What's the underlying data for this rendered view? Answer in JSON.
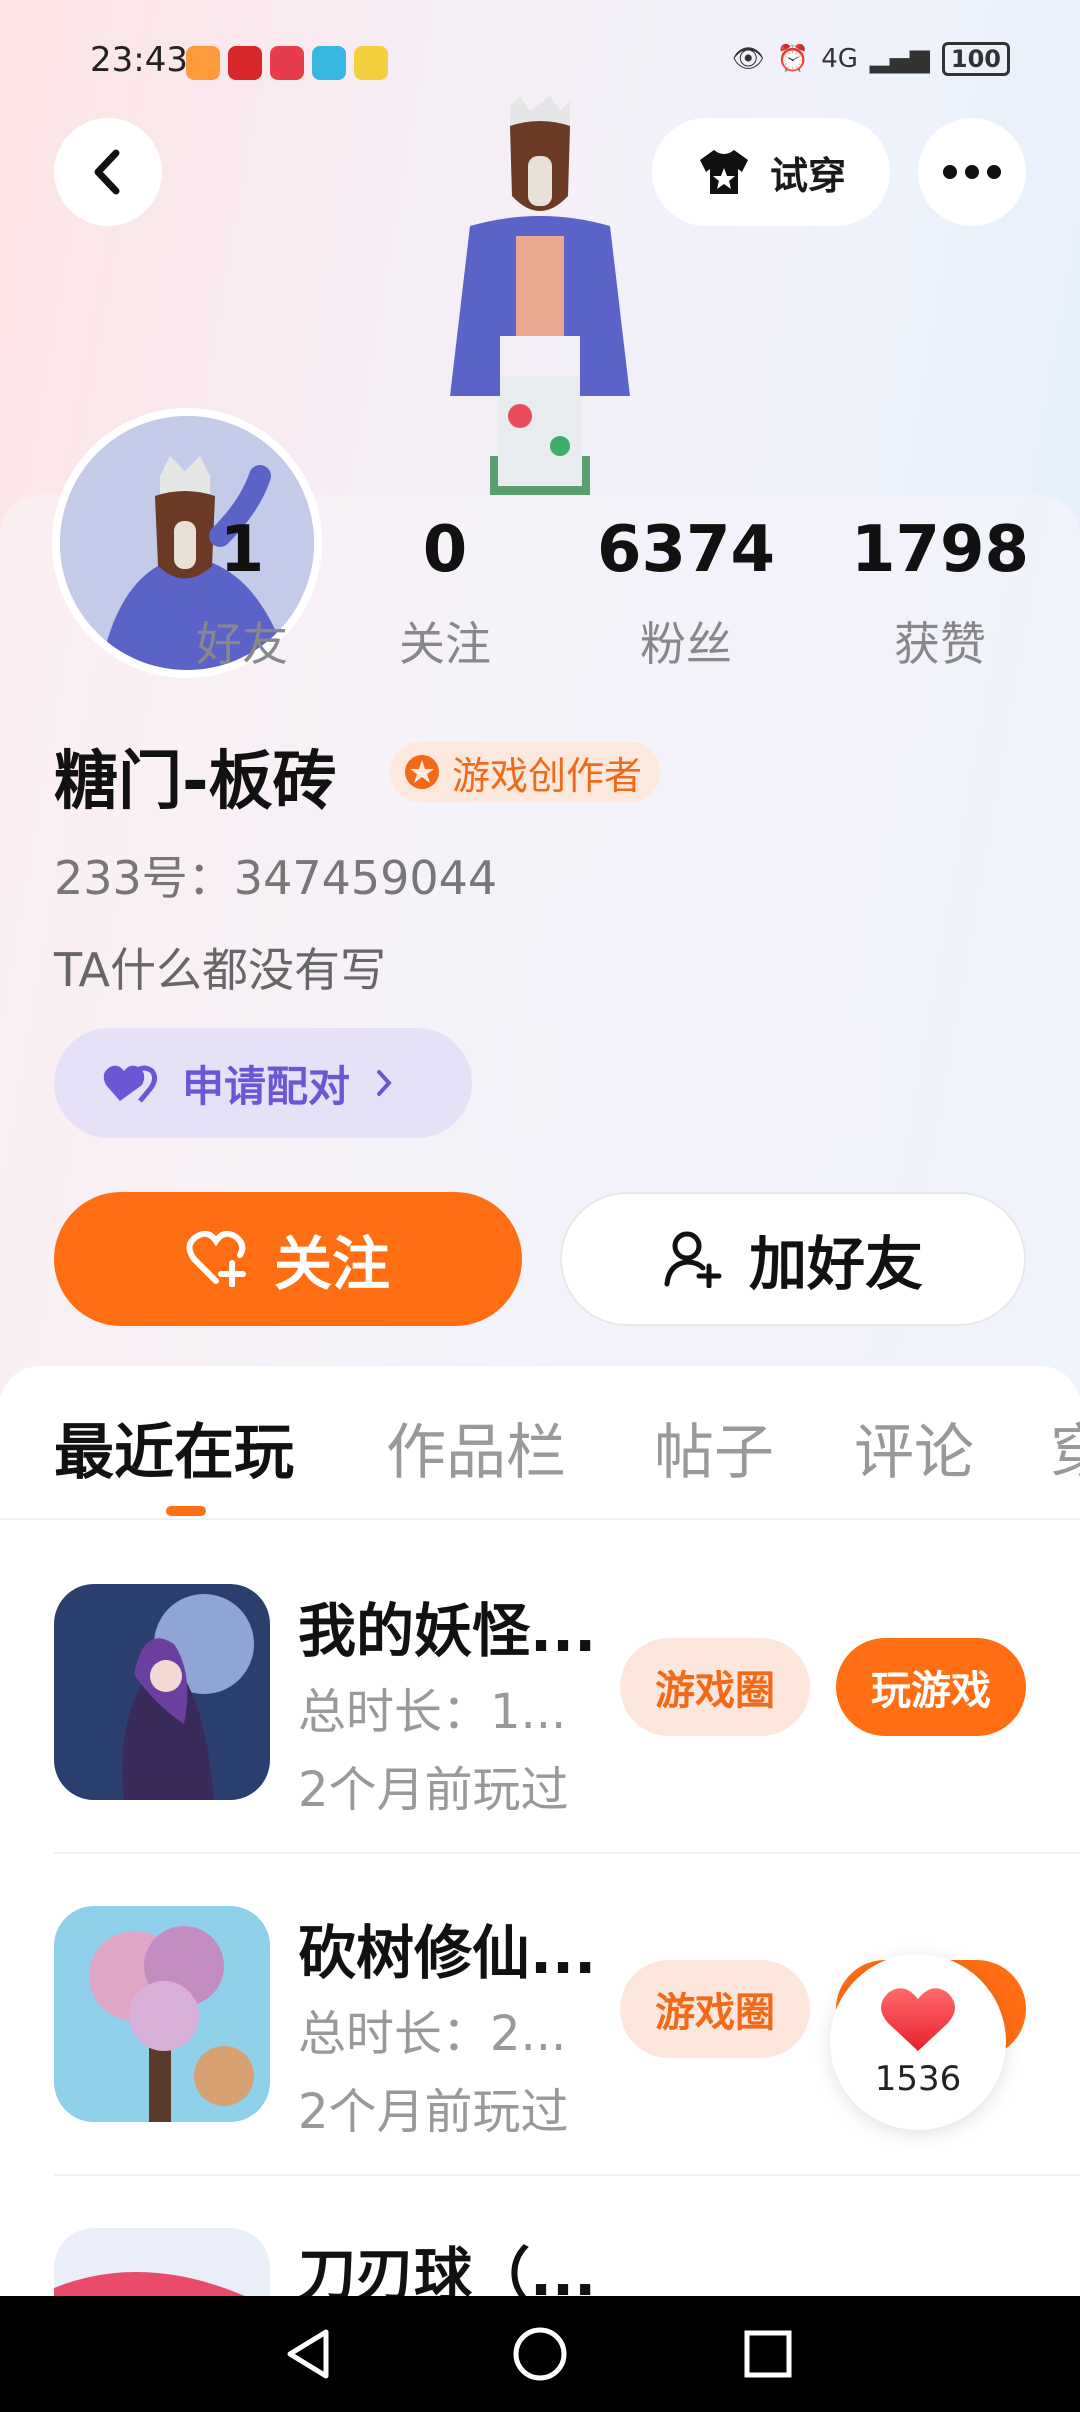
{
  "status_bar": {
    "time": "23:43",
    "battery": "100",
    "network": "4G"
  },
  "header": {
    "tryon_label": "试穿"
  },
  "profile": {
    "stats": [
      {
        "value": "1",
        "label": "好友"
      },
      {
        "value": "0",
        "label": "关注"
      },
      {
        "value": "6374",
        "label": "粉丝"
      },
      {
        "value": "1798",
        "label": "获赞"
      }
    ],
    "name": "糖门-板砖",
    "badge": "游戏创作者",
    "uid": "233号：347459044",
    "bio": "TA什么都没有写",
    "pair_label": "申请配对",
    "follow_label": "关注",
    "add_friend_label": "加好友"
  },
  "tabs": [
    "最近在玩",
    "作品栏",
    "帖子",
    "评论",
    "穿"
  ],
  "games": [
    {
      "title": "我的妖怪...",
      "duration": "总时长：1...",
      "last_played": "2个月前玩过",
      "circle": "游戏圈",
      "play": "玩游戏"
    },
    {
      "title": "砍树修仙...",
      "duration": "总时长：2...",
      "last_played": "2个月前玩过",
      "circle": "游戏圈",
      "play": "玩游戏"
    },
    {
      "title": "刀刃球（...",
      "duration": "",
      "last_played": "",
      "circle": "",
      "play": ""
    }
  ],
  "like_float": {
    "count": "1536"
  },
  "colors": {
    "accent": "#ff6e13",
    "pair": "#6a57d6",
    "badge_bg": "#fde8de"
  }
}
